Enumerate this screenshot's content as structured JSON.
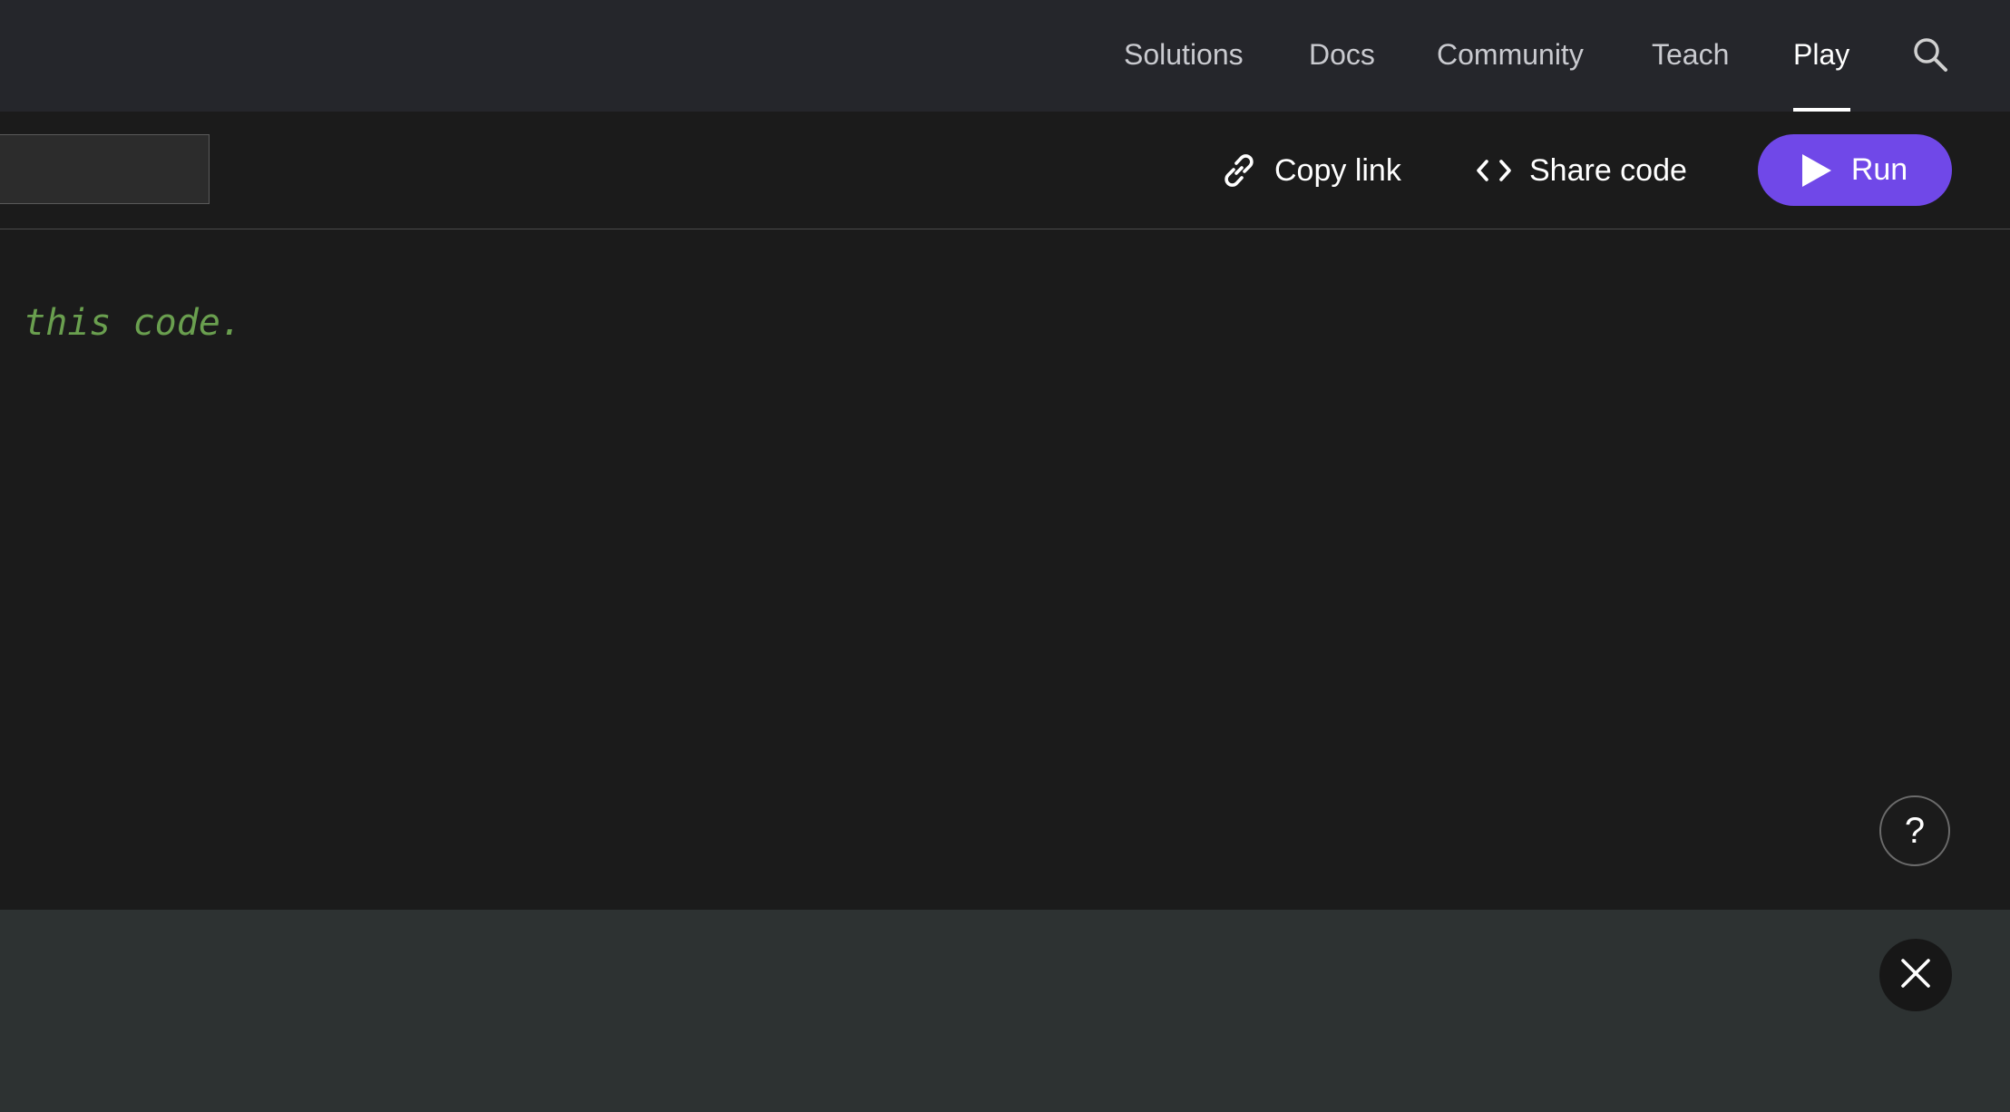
{
  "nav": {
    "items": [
      {
        "label": "Solutions"
      },
      {
        "label": "Docs"
      },
      {
        "label": "Community"
      },
      {
        "label": "Teach"
      },
      {
        "label": "Play"
      }
    ],
    "active_item": "Play",
    "search_icon": "search-icon"
  },
  "toolbar": {
    "title_value": "",
    "copy_link_label": "Copy link",
    "copy_link_icon": "link-icon",
    "share_code_label": "Share code",
    "share_code_icon": "code-brackets-icon",
    "run_label": "Run",
    "run_icon": "play-icon"
  },
  "editor": {
    "visible_code": "e this code."
  },
  "floating": {
    "help_label": "?",
    "close_icon": "close-icon"
  },
  "colors": {
    "accent": "#7048e8",
    "nav_bg": "#25262b",
    "editor_bg": "#1b1b1b",
    "output_bg": "#2d3232",
    "comment_text": "#6a9f4f"
  }
}
